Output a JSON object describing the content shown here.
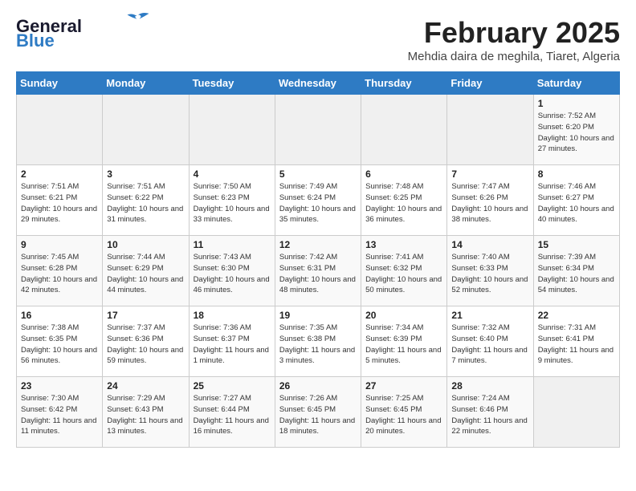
{
  "logo": {
    "line1": "General",
    "line2": "Blue"
  },
  "title": "February 2025",
  "subtitle": "Mehdia daira de meghila, Tiaret, Algeria",
  "days_of_week": [
    "Sunday",
    "Monday",
    "Tuesday",
    "Wednesday",
    "Thursday",
    "Friday",
    "Saturday"
  ],
  "weeks": [
    [
      {
        "day": "",
        "info": ""
      },
      {
        "day": "",
        "info": ""
      },
      {
        "day": "",
        "info": ""
      },
      {
        "day": "",
        "info": ""
      },
      {
        "day": "",
        "info": ""
      },
      {
        "day": "",
        "info": ""
      },
      {
        "day": "1",
        "info": "Sunrise: 7:52 AM\nSunset: 6:20 PM\nDaylight: 10 hours and 27 minutes."
      }
    ],
    [
      {
        "day": "2",
        "info": "Sunrise: 7:51 AM\nSunset: 6:21 PM\nDaylight: 10 hours and 29 minutes."
      },
      {
        "day": "3",
        "info": "Sunrise: 7:51 AM\nSunset: 6:22 PM\nDaylight: 10 hours and 31 minutes."
      },
      {
        "day": "4",
        "info": "Sunrise: 7:50 AM\nSunset: 6:23 PM\nDaylight: 10 hours and 33 minutes."
      },
      {
        "day": "5",
        "info": "Sunrise: 7:49 AM\nSunset: 6:24 PM\nDaylight: 10 hours and 35 minutes."
      },
      {
        "day": "6",
        "info": "Sunrise: 7:48 AM\nSunset: 6:25 PM\nDaylight: 10 hours and 36 minutes."
      },
      {
        "day": "7",
        "info": "Sunrise: 7:47 AM\nSunset: 6:26 PM\nDaylight: 10 hours and 38 minutes."
      },
      {
        "day": "8",
        "info": "Sunrise: 7:46 AM\nSunset: 6:27 PM\nDaylight: 10 hours and 40 minutes."
      }
    ],
    [
      {
        "day": "9",
        "info": "Sunrise: 7:45 AM\nSunset: 6:28 PM\nDaylight: 10 hours and 42 minutes."
      },
      {
        "day": "10",
        "info": "Sunrise: 7:44 AM\nSunset: 6:29 PM\nDaylight: 10 hours and 44 minutes."
      },
      {
        "day": "11",
        "info": "Sunrise: 7:43 AM\nSunset: 6:30 PM\nDaylight: 10 hours and 46 minutes."
      },
      {
        "day": "12",
        "info": "Sunrise: 7:42 AM\nSunset: 6:31 PM\nDaylight: 10 hours and 48 minutes."
      },
      {
        "day": "13",
        "info": "Sunrise: 7:41 AM\nSunset: 6:32 PM\nDaylight: 10 hours and 50 minutes."
      },
      {
        "day": "14",
        "info": "Sunrise: 7:40 AM\nSunset: 6:33 PM\nDaylight: 10 hours and 52 minutes."
      },
      {
        "day": "15",
        "info": "Sunrise: 7:39 AM\nSunset: 6:34 PM\nDaylight: 10 hours and 54 minutes."
      }
    ],
    [
      {
        "day": "16",
        "info": "Sunrise: 7:38 AM\nSunset: 6:35 PM\nDaylight: 10 hours and 56 minutes."
      },
      {
        "day": "17",
        "info": "Sunrise: 7:37 AM\nSunset: 6:36 PM\nDaylight: 10 hours and 59 minutes."
      },
      {
        "day": "18",
        "info": "Sunrise: 7:36 AM\nSunset: 6:37 PM\nDaylight: 11 hours and 1 minute."
      },
      {
        "day": "19",
        "info": "Sunrise: 7:35 AM\nSunset: 6:38 PM\nDaylight: 11 hours and 3 minutes."
      },
      {
        "day": "20",
        "info": "Sunrise: 7:34 AM\nSunset: 6:39 PM\nDaylight: 11 hours and 5 minutes."
      },
      {
        "day": "21",
        "info": "Sunrise: 7:32 AM\nSunset: 6:40 PM\nDaylight: 11 hours and 7 minutes."
      },
      {
        "day": "22",
        "info": "Sunrise: 7:31 AM\nSunset: 6:41 PM\nDaylight: 11 hours and 9 minutes."
      }
    ],
    [
      {
        "day": "23",
        "info": "Sunrise: 7:30 AM\nSunset: 6:42 PM\nDaylight: 11 hours and 11 minutes."
      },
      {
        "day": "24",
        "info": "Sunrise: 7:29 AM\nSunset: 6:43 PM\nDaylight: 11 hours and 13 minutes."
      },
      {
        "day": "25",
        "info": "Sunrise: 7:27 AM\nSunset: 6:44 PM\nDaylight: 11 hours and 16 minutes."
      },
      {
        "day": "26",
        "info": "Sunrise: 7:26 AM\nSunset: 6:45 PM\nDaylight: 11 hours and 18 minutes."
      },
      {
        "day": "27",
        "info": "Sunrise: 7:25 AM\nSunset: 6:45 PM\nDaylight: 11 hours and 20 minutes."
      },
      {
        "day": "28",
        "info": "Sunrise: 7:24 AM\nSunset: 6:46 PM\nDaylight: 11 hours and 22 minutes."
      },
      {
        "day": "",
        "info": ""
      }
    ]
  ]
}
